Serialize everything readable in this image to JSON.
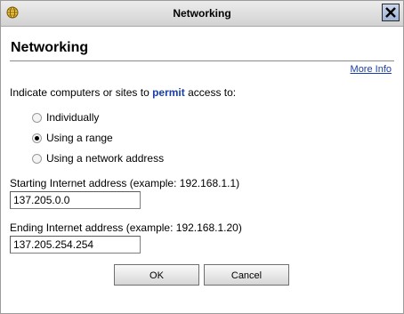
{
  "window": {
    "title": "Networking",
    "icon": "globe-icon",
    "close_icon": "close-icon"
  },
  "content": {
    "heading": "Networking",
    "more_info": "More Info",
    "prompt_before": "Indicate computers or sites to ",
    "prompt_keyword": "permit",
    "prompt_after": " access to:",
    "options": [
      {
        "label": "Individually",
        "selected": false
      },
      {
        "label": "Using a range",
        "selected": true
      },
      {
        "label": "Using a network address",
        "selected": false
      }
    ],
    "start_label": "Starting Internet address (example: 192.168.1.1)",
    "start_value": "137.205.0.0",
    "end_label": "Ending Internet address (example: 192.168.1.20)",
    "end_value": "137.205.254.254"
  },
  "buttons": {
    "ok": "OK",
    "cancel": "Cancel"
  },
  "colors": {
    "link": "#1a3ea8",
    "keyword": "#1a3ea8"
  }
}
